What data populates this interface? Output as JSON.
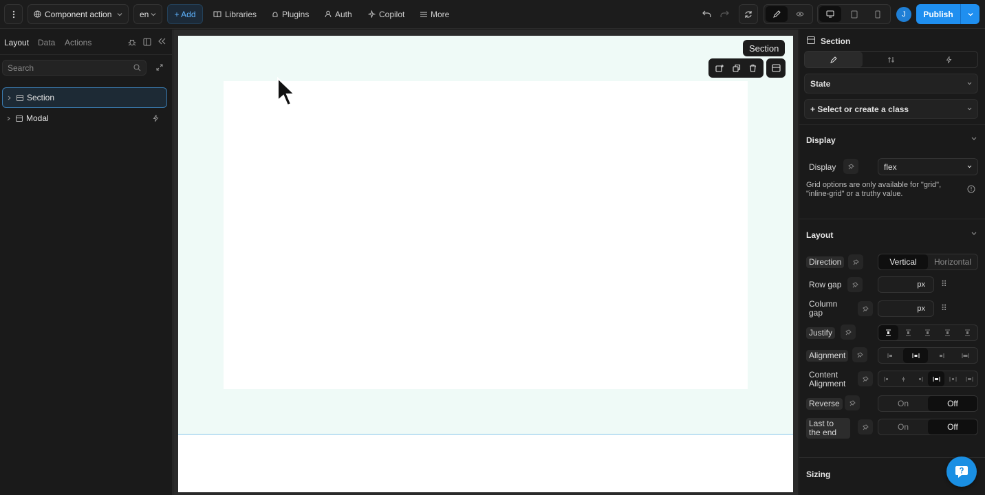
{
  "topbar": {
    "component_name": "Component action",
    "language": "en",
    "add_label": "+ Add",
    "nav": [
      "Libraries",
      "Plugins",
      "Auth",
      "Copilot",
      "More"
    ],
    "avatar_initial": "J",
    "publish_label": "Publish"
  },
  "left_panel": {
    "tabs": [
      "Layout",
      "Data",
      "Actions"
    ],
    "search_placeholder": "Search",
    "tree": [
      {
        "label": "Section"
      },
      {
        "label": "Modal"
      }
    ]
  },
  "canvas": {
    "selected_tag": "Section"
  },
  "right_panel": {
    "element_title": "Section",
    "state_label": "State",
    "class_label": "+ Select or create a class",
    "display_section": {
      "heading": "Display",
      "display_label": "Display",
      "display_value": "flex",
      "note": "Grid options are only available for \"grid\", \"inline-grid\" or a truthy value."
    },
    "layout_section": {
      "heading": "Layout",
      "direction_label": "Direction",
      "direction_options": [
        "Vertical",
        "Horizontal"
      ],
      "row_gap_label": "Row gap",
      "row_gap_unit": "px",
      "column_gap_label": "Column gap",
      "column_gap_unit": "px",
      "justify_label": "Justify",
      "alignment_label": "Alignment",
      "content_alignment_label": "Content Alignment",
      "reverse_label": "Reverse",
      "reverse_options": [
        "On",
        "Off"
      ],
      "last_to_end_label": "Last to the end",
      "last_to_end_options": [
        "On",
        "Off"
      ]
    },
    "sizing_section": {
      "heading": "Sizing"
    }
  },
  "colors": {
    "accent": "#1f8ff0",
    "section_bg": "#effaf7",
    "selection_line": "#7fc3e6",
    "help_button": "#1a8fe3"
  }
}
